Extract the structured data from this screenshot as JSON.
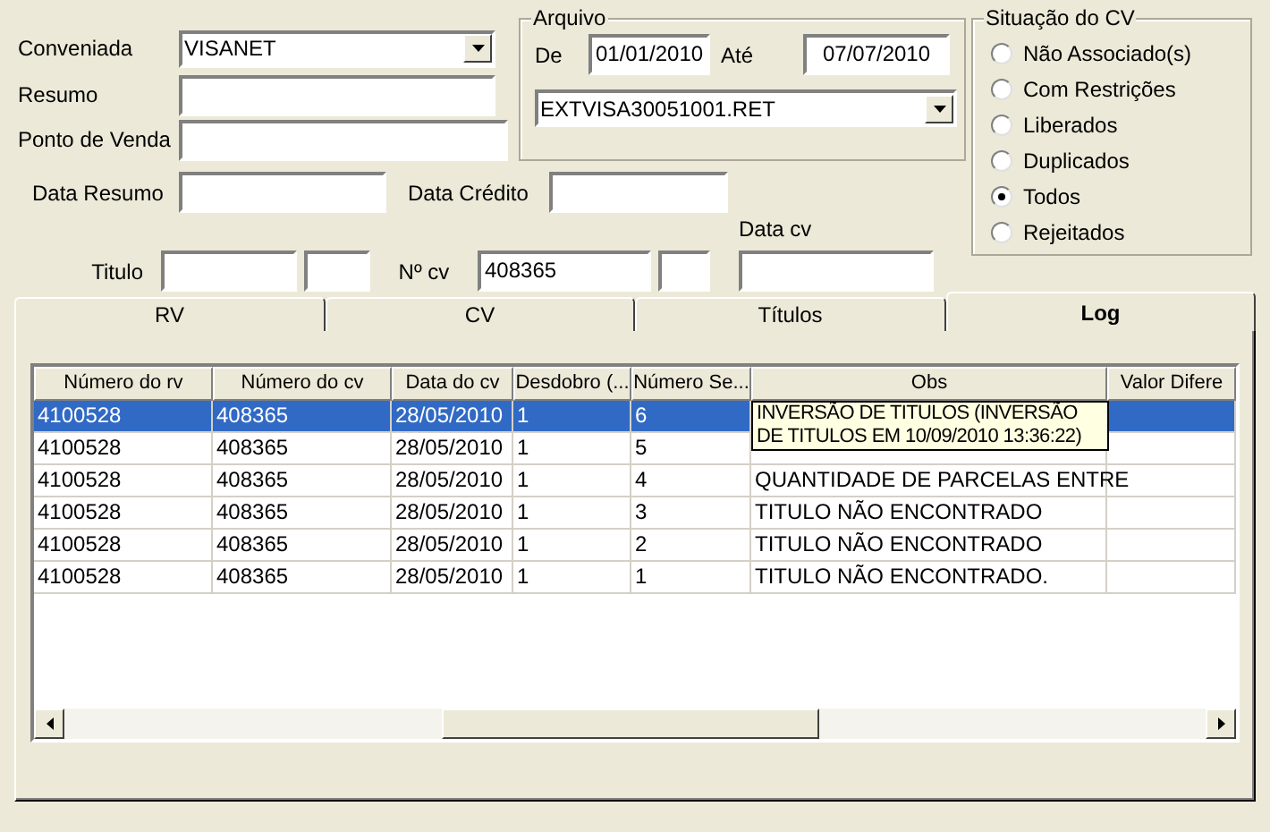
{
  "form": {
    "conveniada": {
      "label": "Conveniada",
      "value": "VISANET"
    },
    "resumo": {
      "label": "Resumo"
    },
    "ponto_venda": {
      "label": "Ponto de Venda"
    },
    "data_resumo": {
      "label": "Data Resumo"
    },
    "data_credito": {
      "label": "Data Crédito"
    },
    "titulo": {
      "label": "Titulo"
    },
    "numero_cv": {
      "label": "Nº cv",
      "value": "408365"
    },
    "data_cv": {
      "label": "Data cv"
    }
  },
  "arquivo": {
    "title": "Arquivo",
    "de": {
      "label": "De",
      "value": "01/01/2010"
    },
    "ate": {
      "label": "Até",
      "value": "07/07/2010"
    },
    "file": {
      "value": "EXTVISA30051001.RET"
    }
  },
  "situacao": {
    "title": "Situação do CV",
    "options": [
      {
        "label": "Não Associado(s)",
        "selected": false
      },
      {
        "label": "Com Restrições",
        "selected": false
      },
      {
        "label": "Liberados",
        "selected": false
      },
      {
        "label": "Duplicados",
        "selected": false
      },
      {
        "label": "Todos",
        "selected": true
      },
      {
        "label": "Rejeitados",
        "selected": false
      }
    ]
  },
  "tabs": [
    {
      "label": "RV",
      "selected": false
    },
    {
      "label": "CV",
      "selected": false
    },
    {
      "label": "Títulos",
      "selected": false
    },
    {
      "label": "Log",
      "selected": true
    }
  ],
  "table": {
    "columns": [
      "Número do rv",
      "Número do cv",
      "Data do cv",
      "Desdobro (...",
      "Número Se...",
      "Obs",
      "Valor Difere"
    ],
    "rows": [
      {
        "selected": true,
        "cells": [
          "4100528",
          "408365",
          "28/05/2010",
          "1",
          "6"
        ]
      },
      {
        "selected": false,
        "cells": [
          "4100528",
          "408365",
          "28/05/2010",
          "1",
          "5"
        ]
      },
      {
        "selected": false,
        "cells": [
          "4100528",
          "408365",
          "28/05/2010",
          "1",
          "4",
          "QUANTIDADE DE PARCELAS ENTRE"
        ]
      },
      {
        "selected": false,
        "cells": [
          "4100528",
          "408365",
          "28/05/2010",
          "1",
          "3",
          "TITULO NÃO ENCONTRADO"
        ]
      },
      {
        "selected": false,
        "cells": [
          "4100528",
          "408365",
          "28/05/2010",
          "1",
          "2",
          "TITULO NÃO ENCONTRADO"
        ]
      },
      {
        "selected": false,
        "cells": [
          "4100528",
          "408365",
          "28/05/2010",
          "1",
          "1",
          "TITULO NÃO ENCONTRADO."
        ]
      }
    ],
    "tooltip": "INVERSÃO DE TITULOS (INVERSÃO DE TITULOS EM 10/09/2010 13:36:22)"
  }
}
